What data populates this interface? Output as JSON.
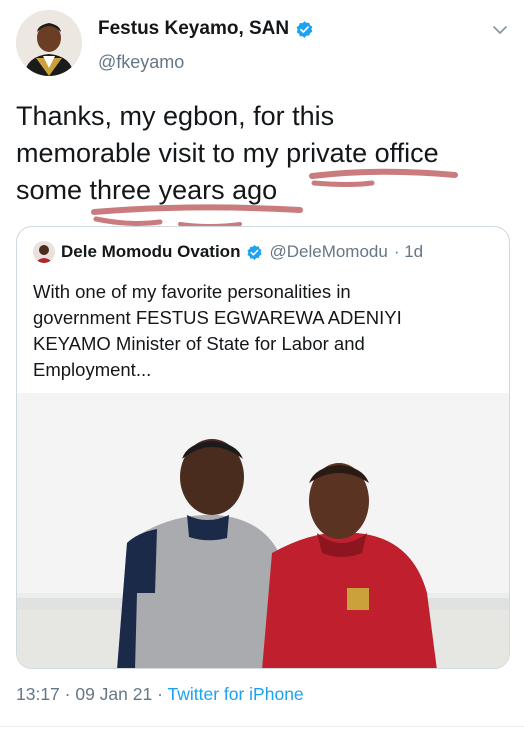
{
  "tweet": {
    "author_name": "Festus Keyamo, SAN",
    "author_handle": "@fkeyamo",
    "text_line1": "Thanks, my egbon, for this",
    "text_line2": "memorable visit to my private office",
    "text_line3": "some three years ago",
    "time": "13:17",
    "sep1": " · ",
    "date": "09 Jan 21",
    "sep2": " · ",
    "source": "Twitter for iPhone"
  },
  "quote": {
    "author_name": "Dele Momodu Ovation",
    "author_handle": "@DeleMomodu",
    "age": "· 1d",
    "text_line1": "With one of my favorite personalities in",
    "text_line2": "government FESTUS EGWAREWA ADENIYI",
    "text_line3": "KEYAMO Minister of State for Labor and",
    "text_line4": "Employment..."
  },
  "colors": {
    "accent": "#1da1f2",
    "secondary_text": "#657786",
    "annotation": "#c97b7e"
  },
  "icons": [
    "verified-badge-icon",
    "chevron-down-icon"
  ]
}
